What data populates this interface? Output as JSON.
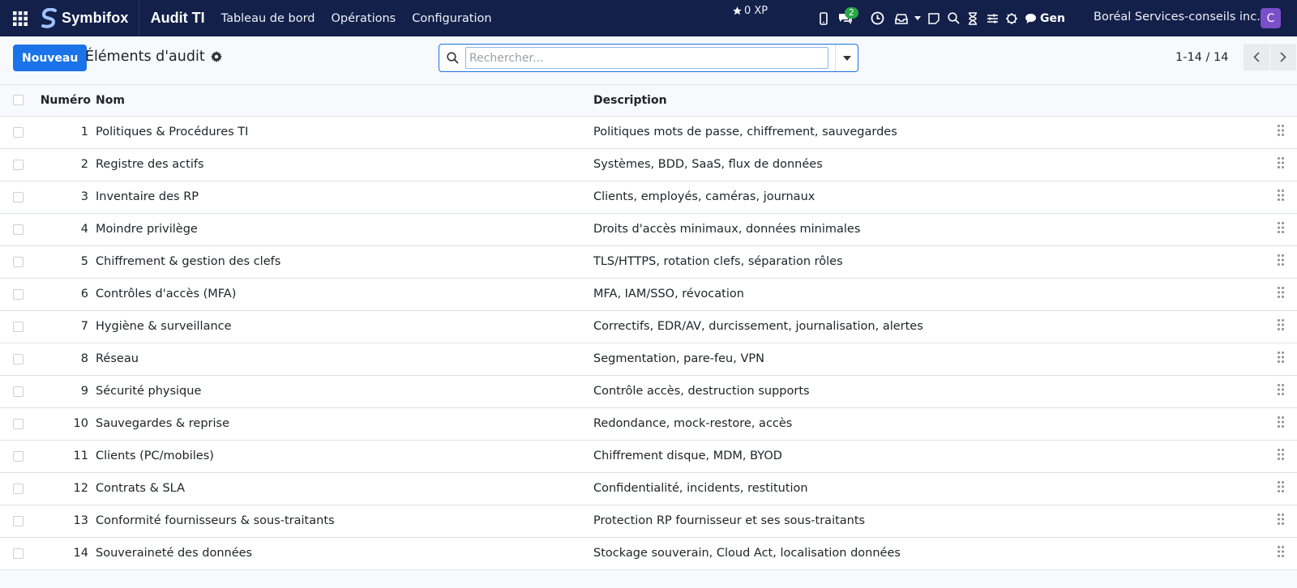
{
  "navbar": {
    "brand": "Symbifox",
    "app_title": "Audit TI",
    "menu": [
      "Tableau de bord",
      "Opérations",
      "Configuration"
    ],
    "xp": "0 XP",
    "messages_count": "2",
    "gen_label": "Gen",
    "company": "Boréal Services-conseils inc.",
    "avatar_letter": "C",
    "avatar_color": "#7b4fc9"
  },
  "control": {
    "new_button": "Nouveau",
    "title": "Éléments d'audit",
    "search_placeholder": "Rechercher...",
    "pager": "1-14 / 14"
  },
  "table": {
    "headers": {
      "number": "Numéro",
      "name": "Nom",
      "description": "Description"
    },
    "rows": [
      {
        "number": "1",
        "name": "Politiques & Procédures TI",
        "description": "Politiques mots de passe, chiffrement, sauvegardes"
      },
      {
        "number": "2",
        "name": "Registre des actifs",
        "description": "Systèmes, BDD, SaaS, flux de données"
      },
      {
        "number": "3",
        "name": "Inventaire des RP",
        "description": "Clients, employés, caméras, journaux"
      },
      {
        "number": "4",
        "name": "Moindre privilège",
        "description": "Droits d'accès minimaux, données minimales"
      },
      {
        "number": "5",
        "name": "Chiffrement & gestion des clefs",
        "description": "TLS/HTTPS, rotation clefs, séparation rôles"
      },
      {
        "number": "6",
        "name": "Contrôles d'accès (MFA)",
        "description": "MFA, IAM/SSO, révocation"
      },
      {
        "number": "7",
        "name": "Hygiène & surveillance",
        "description": "Correctifs, EDR/AV, durcissement, journalisation, alertes"
      },
      {
        "number": "8",
        "name": "Réseau",
        "description": "Segmentation, pare-feu, VPN"
      },
      {
        "number": "9",
        "name": "Sécurité physique",
        "description": "Contrôle accès, destruction supports"
      },
      {
        "number": "10",
        "name": "Sauvegardes & reprise",
        "description": "Redondance, mock-restore, accès"
      },
      {
        "number": "11",
        "name": "Clients (PC/mobiles)",
        "description": "Chiffrement disque, MDM, BYOD"
      },
      {
        "number": "12",
        "name": "Contrats & SLA",
        "description": "Confidentialité, incidents, restitution"
      },
      {
        "number": "13",
        "name": "Conformité fournisseurs & sous-traitants",
        "description": "Protection RP fournisseur et ses sous-traitants"
      },
      {
        "number": "14",
        "name": "Souveraineté des données",
        "description": "Stockage souverain, Cloud Act, localisation données"
      }
    ]
  },
  "colors": {
    "navbar": "#13204a",
    "primary": "#1a73e8",
    "badge": "#28a745"
  }
}
